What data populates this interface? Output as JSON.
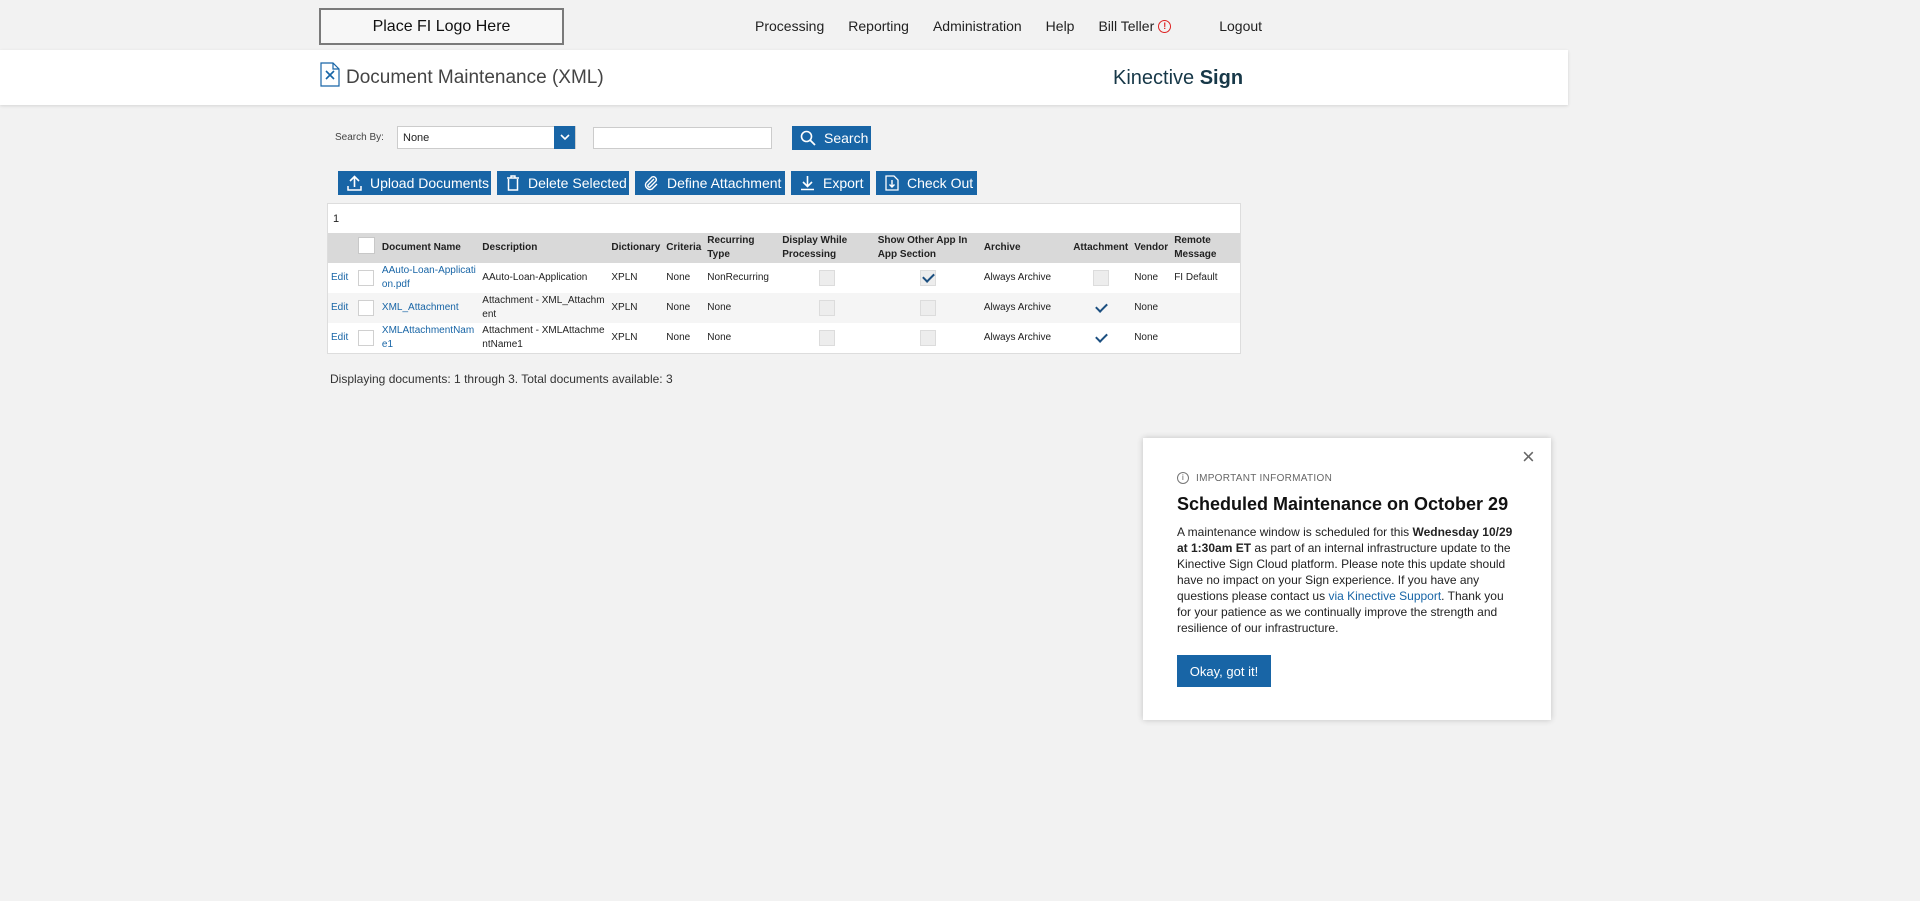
{
  "header": {
    "logo_placeholder": "Place FI Logo Here",
    "nav": [
      "Processing",
      "Reporting",
      "Administration",
      "Help"
    ],
    "user_name": "Bill Teller",
    "logout": "Logout"
  },
  "title_band": {
    "page_title": "Document Maintenance (XML)",
    "brand_light": "Kinective",
    "brand_bold": "Sign"
  },
  "search": {
    "label": "Search By:",
    "selected": "None",
    "query": "",
    "button": "Search"
  },
  "actions": {
    "upload": "Upload Documents",
    "delete": "Delete Selected",
    "define_attachment": "Define Attachment",
    "export": "Export",
    "check_out": "Check Out"
  },
  "pager": "1",
  "table": {
    "headers": {
      "document_name": "Document Name",
      "description": "Description",
      "dictionary": "Dictionary",
      "criteria": "Criteria",
      "recurring_type": "Recurring Type",
      "display_while_processing": "Display While Processing",
      "show_other_app": "Show Other App In App Section",
      "archive": "Archive",
      "attachment": "Attachment",
      "vendor": "Vendor",
      "remote_message": "Remote Message"
    },
    "rows": [
      {
        "edit": "Edit",
        "document_name": "AAuto-Loan-Application.pdf",
        "description": "AAuto-Loan-Application",
        "dictionary": "XPLN",
        "criteria": "None",
        "recurring_type": "NonRecurring",
        "display_while_processing": false,
        "show_other_app": true,
        "archive": "Always Archive",
        "attachment": false,
        "vendor": "None",
        "remote_message": "FI Default"
      },
      {
        "edit": "Edit",
        "document_name": "XML_Attachment",
        "description": "Attachment - XML_Attachment",
        "dictionary": "XPLN",
        "criteria": "None",
        "recurring_type": "None",
        "display_while_processing": false,
        "show_other_app": false,
        "archive": "Always Archive",
        "attachment": true,
        "vendor": "None",
        "remote_message": ""
      },
      {
        "edit": "Edit",
        "document_name": "XMLAttachmentName1",
        "description": "Attachment - XMLAttachmentName1",
        "dictionary": "XPLN",
        "criteria": "None",
        "recurring_type": "None",
        "display_while_processing": false,
        "show_other_app": false,
        "archive": "Always Archive",
        "attachment": true,
        "vendor": "None",
        "remote_message": ""
      }
    ]
  },
  "display_info": "Displaying documents: 1 through 3. Total documents available: 3",
  "modal": {
    "eyebrow": "IMPORTANT INFORMATION",
    "title": "Scheduled Maintenance on October 29",
    "body_1": "A maintenance window is scheduled for this ",
    "body_bold": "Wednesday 10/29 at 1:30am ET",
    "body_2": " as part of an internal infrastructure update to the Kinective Sign Cloud platform. Please note this update should have no impact on your Sign experience. If you have any questions please contact us ",
    "body_link": "via Kinective Support",
    "body_3": ". Thank you for your patience as we continually improve the strength and resilience of our infrastructure.",
    "ok_button": "Okay, got it!"
  },
  "colors": {
    "primary": "#1865a6",
    "brand_text": "#173848",
    "alert": "#dd2222"
  }
}
